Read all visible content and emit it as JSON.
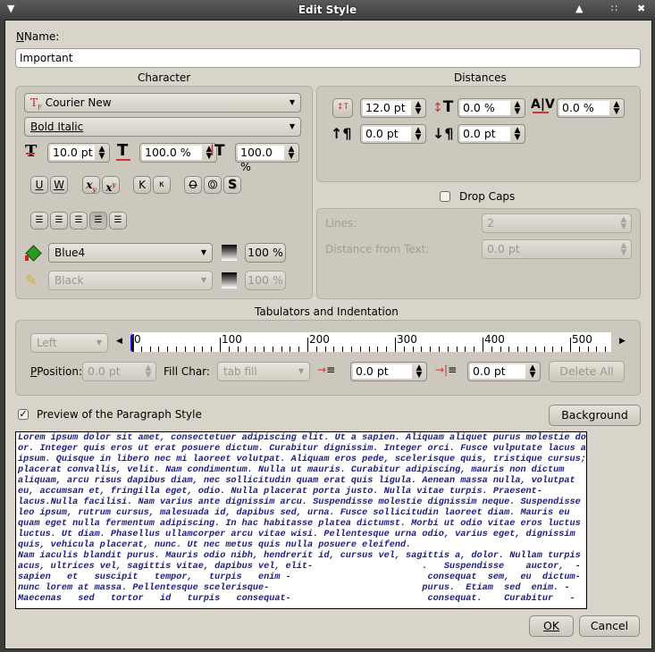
{
  "window": {
    "title": "Edit Style",
    "menu_glyph": "▼",
    "shade_glyph": "▲",
    "max_glyph": "∷",
    "close_glyph": "✖"
  },
  "name": {
    "label": "Name:",
    "value": "Important"
  },
  "character": {
    "title": "Character",
    "font_family": "Courier New",
    "font_style": "Bold Italic",
    "font_size": "10.0 pt",
    "scale_width": "100.0 %",
    "scale_height": "100.0 %",
    "style_buttons": [
      {
        "name": "underline",
        "glyph": "U"
      },
      {
        "name": "underline-words",
        "glyph": "W"
      },
      {
        "name": "subscript",
        "glyph": "x"
      },
      {
        "name": "superscript",
        "glyph": "x"
      },
      {
        "name": "all-caps",
        "glyph": "K"
      },
      {
        "name": "small-caps",
        "glyph": "κ"
      },
      {
        "name": "strikethrough",
        "glyph": "O"
      },
      {
        "name": "outline",
        "glyph": "O"
      },
      {
        "name": "shadow",
        "glyph": "S"
      }
    ],
    "alignment": [
      "left",
      "center",
      "right",
      "block",
      "forced"
    ],
    "alignment_selected": "block",
    "fill_color": "Blue4",
    "fill_shade": "100 %",
    "stroke_color": "Black",
    "stroke_shade": "100 %"
  },
  "distances": {
    "title": "Distances",
    "line_spacing": "12.0 pt",
    "baseline_offset": "0.0 %",
    "tracking": "0.0 %",
    "space_above": "0.0 pt",
    "space_below": "0.0 pt"
  },
  "drop_caps": {
    "label": "Drop Caps",
    "checked": false,
    "lines_label": "Lines:",
    "lines_value": "2",
    "distance_label": "Distance from Text:",
    "distance_value": "0.0 pt"
  },
  "tabs": {
    "title": "Tabulators and Indentation",
    "type": "Left",
    "ruler_labels": [
      "0",
      "100",
      "200",
      "300",
      "400",
      "500"
    ],
    "position_label": "Position:",
    "position_value": "0.0 pt",
    "fill_char_label": "Fill Char:",
    "fill_char_value": "tab fill",
    "first_line_indent": "0.0 pt",
    "left_indent": "0.0 pt",
    "delete_all": "Delete All"
  },
  "preview": {
    "checkbox_label": "Preview of the Paragraph Style",
    "checked": true,
    "background_button": "Background",
    "lines": [
      "Lorem ipsum dolor sit amet, consectetuer adipiscing elit. Ut a sapien. Aliquam aliquet purus molestie dol-",
      "or. Integer quis eros ut erat posuere dictum. Curabitur dignissim. Integer orci. Fusce vulputate lacus at-",
      "ipsum. Quisque in libero nec mi laoreet volutpat. Aliquam eros pede, scelerisque quis, tristique cursus;",
      "placerat convallis, velit. Nam condimentum. Nulla ut mauris. Curabitur adipiscing, mauris non dictum",
      "aliquam, arcu risus dapibus diam, nec sollicitudin quam erat quis ligula. Aenean massa nulla, volutpat",
      "eu, accumsan et, fringilla eget, odio. Nulla placerat porta justo. Nulla vitae turpis. Praesent-",
      "lacus.Nulla facilisi. Nam varius ante dignissim arcu. Suspendisse molestie dignissim neque. Suspendisse",
      "leo ipsum, rutrum cursus, malesuada id, dapibus sed, urna. Fusce sollicitudin laoreet diam. Mauris eu",
      "quam eget nulla fermentum adipiscing. In hac habitasse platea dictumst. Morbi ut odio vitae eros luctus",
      "luctus. Ut diam. Phasellus ullamcorper arcu vitae wisi. Pellentesque urna odio, varius eget, dignissim",
      "quis, vehicula placerat, nunc. Ut nec metus quis nulla posuere eleifend.",
      "Nam iaculis blandit purus. Mauris odio nibh, hendrerit id, cursus vel, sagittis a, dolor. Nullam turpis l-",
      "acus, ultrices vel, sagittis vitae, dapibus vel, elit-                    .   Suspendisse    auctor,  -",
      "sapien   et   suscipit   tempor,   turpis   enim -                         consequat  sem,  eu  dictum-",
      "nunc lorem at massa. Pellentesque scelerisque-                            purus.  Etiam  sed  enim. -",
      "Maecenas   sed   tortor   id   turpis   consequat-                         consequat.    Curabitur   -"
    ]
  },
  "footer": {
    "ok": "OK",
    "cancel": "Cancel"
  }
}
